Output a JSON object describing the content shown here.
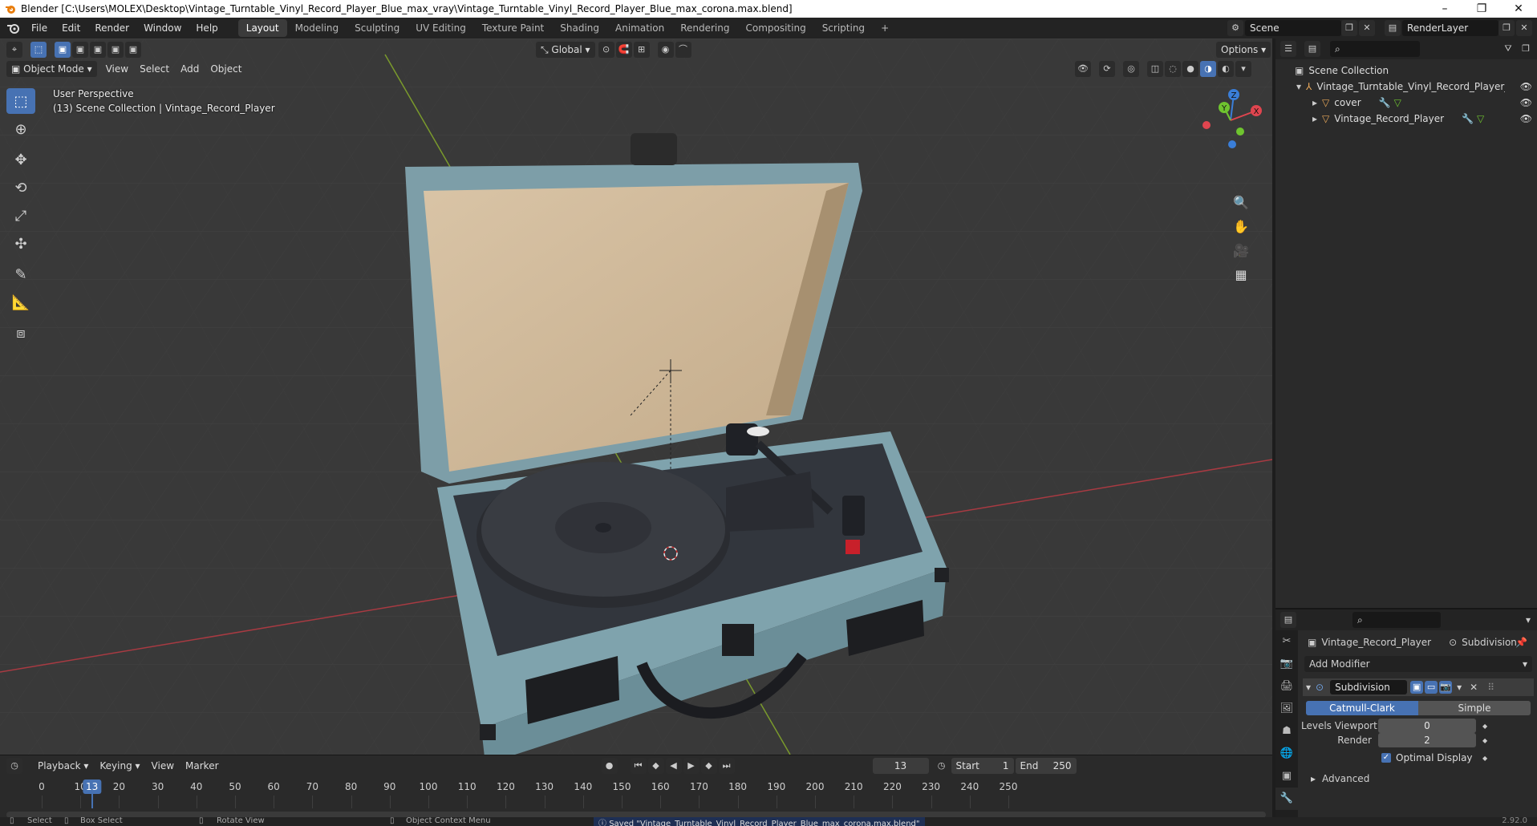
{
  "window": {
    "title": "Blender [C:\\Users\\MOLEX\\Desktop\\Vintage_Turntable_Vinyl_Record_Player_Blue_max_vray\\Vintage_Turntable_Vinyl_Record_Player_Blue_max_corona.max.blend]",
    "minimize": "–",
    "maximize": "❐",
    "close": "✕"
  },
  "menu": [
    "File",
    "Edit",
    "Render",
    "Window",
    "Help"
  ],
  "workspaces": [
    "Layout",
    "Modeling",
    "Sculpting",
    "UV Editing",
    "Texture Paint",
    "Shading",
    "Animation",
    "Rendering",
    "Compositing",
    "Scripting"
  ],
  "active_workspace": "Layout",
  "scene": {
    "name": "Scene",
    "render_layer": "RenderLayer"
  },
  "viewport_header": {
    "mode": "Object Mode",
    "menus": [
      "View",
      "Select",
      "Add",
      "Object"
    ],
    "transform_orientation": "Global",
    "options": "Options"
  },
  "viewport_info": {
    "perspective": "User Perspective",
    "collection": "(13) Scene Collection | Vintage_Record_Player"
  },
  "gizmo": {
    "x": "X",
    "y": "Y",
    "z": "Z"
  },
  "outliner": {
    "root": "Scene Collection",
    "items": [
      {
        "label": "Vintage_Turntable_Vinyl_Record_Player_Blue",
        "depth": 1
      },
      {
        "label": "cover",
        "depth": 2
      },
      {
        "label": "Vintage_Record_Player",
        "depth": 2
      }
    ]
  },
  "properties": {
    "object": "Vintage_Record_Player",
    "modifier_name_crumb": "Subdivision",
    "add_modifier": "Add Modifier",
    "modifier": {
      "name": "Subdivision",
      "type_options": [
        "Catmull-Clark",
        "Simple"
      ],
      "selected_type": "Catmull-Clark",
      "levels_viewport_label": "Levels Viewport",
      "levels_viewport": "0",
      "render_label": "Render",
      "render": "2",
      "optimal_display_label": "Optimal Display",
      "optimal_display": true,
      "advanced": "Advanced"
    }
  },
  "timeline": {
    "menus": [
      "Playback",
      "Keying",
      "View",
      "Marker"
    ],
    "current_frame": "13",
    "start_label": "Start",
    "start": "1",
    "end_label": "End",
    "end": "250",
    "ticks": [
      "0",
      "10",
      "20",
      "30",
      "40",
      "50",
      "60",
      "70",
      "80",
      "90",
      "100",
      "110",
      "120",
      "130",
      "140",
      "150",
      "160",
      "170",
      "180",
      "190",
      "200",
      "210",
      "220",
      "230",
      "240",
      "250"
    ]
  },
  "status": {
    "select": "Select",
    "box_select": "Box Select",
    "rotate_view": "Rotate View",
    "context_menu": "Object Context Menu",
    "message": "Saved \"Vintage_Turntable_Vinyl_Record_Player_Blue_max_corona.max.blend\"",
    "version": "2.92.0"
  },
  "colors": {
    "accent": "#4772b3",
    "axis_x": "#e0454f",
    "axis_y": "#6fc42f",
    "axis_z": "#3a7ed8",
    "case_blue": "#7fa3ad"
  }
}
